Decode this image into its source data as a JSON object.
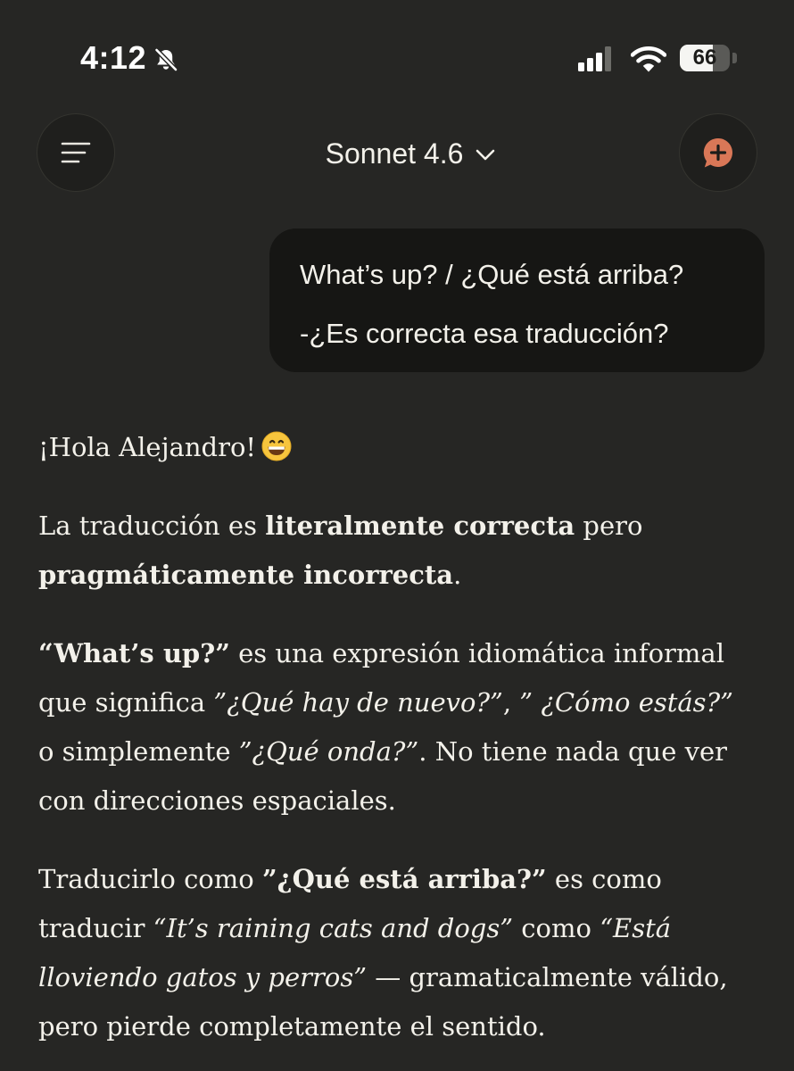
{
  "status_bar": {
    "time": "4:12",
    "mute_icon": "bell-slash-icon",
    "signal_icon": "cellular-signal-icon",
    "wifi_icon": "wifi-icon",
    "battery_level": 66,
    "battery_text": "66"
  },
  "header": {
    "menu_icon": "menu-lines-icon",
    "model_name": "Sonnet 4.6",
    "model_chevron_icon": "chevron-down-icon",
    "new_chat_icon": "chat-plus-icon",
    "accent_color": "#d97757"
  },
  "user_message": {
    "line1": "What’s up? / ¿Qué está arriba?",
    "line2": "-¿Es correcta esa traducción?"
  },
  "assistant_message": {
    "greeting": "¡Hola Alejandro!",
    "greeting_emoji": "grinning-face-emoji",
    "p2": {
      "t1": "La traducción es ",
      "b1": "literalmente correcta",
      "t2": " pero ",
      "b2": "pragmáticamente incorrecta",
      "t3": "."
    },
    "p3": {
      "b1": "“What’s up?”",
      "t1": " es una expresión idiomática informal que significa ",
      "i1": "”¿Qué hay de nuevo?”",
      "t2": ", ",
      "i2": "” ¿Cómo estás?”",
      "t3": " o simplemente ",
      "i3": "”¿Qué onda?”",
      "t4": ". No tiene nada que ver con direcciones espaciales."
    },
    "p4": {
      "t1": "Traducirlo como ",
      "b1": "”¿Qué está arriba?”",
      "t2": " es como traducir ",
      "i1": "“It’s raining cats and dogs”",
      "t3": " como ",
      "i2": "“Está lloviendo gatos y perros”",
      "t4": " — gramaticalmente válido, pero pierde completamente el sentido."
    }
  }
}
